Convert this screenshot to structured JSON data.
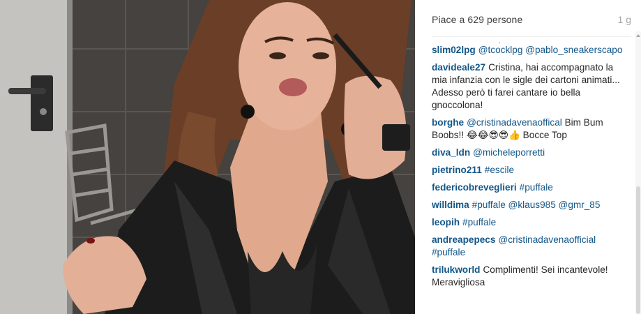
{
  "post": {
    "likes_text": "Piace a 629 persone",
    "age": "1 g",
    "more_indicator": "·"
  },
  "comments": [
    {
      "user": "slim02lpg",
      "segments": [
        {
          "text": "@tcocklpg @pablo_sneakerscapo",
          "link": true
        }
      ]
    },
    {
      "user": "davideale27",
      "segments": [
        {
          "text": "Cristina, hai accompagnato la mia infanzia con le sigle dei cartoni animati... Adesso però ti farei cantare io bella gnoccolona!",
          "link": false
        }
      ]
    },
    {
      "user": "borghe",
      "segments": [
        {
          "text": "@cristinadavenaoffical",
          "link": true
        },
        {
          "text": " Bim Bum Boobs!! 😂😂😎😎👍 Bocce Top",
          "link": false
        }
      ]
    },
    {
      "user": "diva_ldn",
      "segments": [
        {
          "text": "@micheleporretti",
          "link": true
        }
      ]
    },
    {
      "user": "pietrino211",
      "segments": [
        {
          "text": "#escile",
          "link": true
        }
      ]
    },
    {
      "user": "federicobreveglieri",
      "segments": [
        {
          "text": "#puffale",
          "link": true
        }
      ]
    },
    {
      "user": "willdima",
      "segments": [
        {
          "text": "#puffale @klaus985 @gmr_85",
          "link": true
        }
      ]
    },
    {
      "user": "leopih",
      "segments": [
        {
          "text": "#puffale",
          "link": true
        }
      ]
    },
    {
      "user": "andreapepecs",
      "segments": [
        {
          "text": "@cristinadavenaofficial #puffale",
          "link": true
        }
      ]
    },
    {
      "user": "trilukworld",
      "segments": [
        {
          "text": "Complimenti! Sei incantevole! Meravigliosa",
          "link": false
        }
      ]
    }
  ],
  "colors": {
    "username": "#125688",
    "link": "#125688",
    "text": "#262626",
    "muted": "#a5a7aa"
  }
}
